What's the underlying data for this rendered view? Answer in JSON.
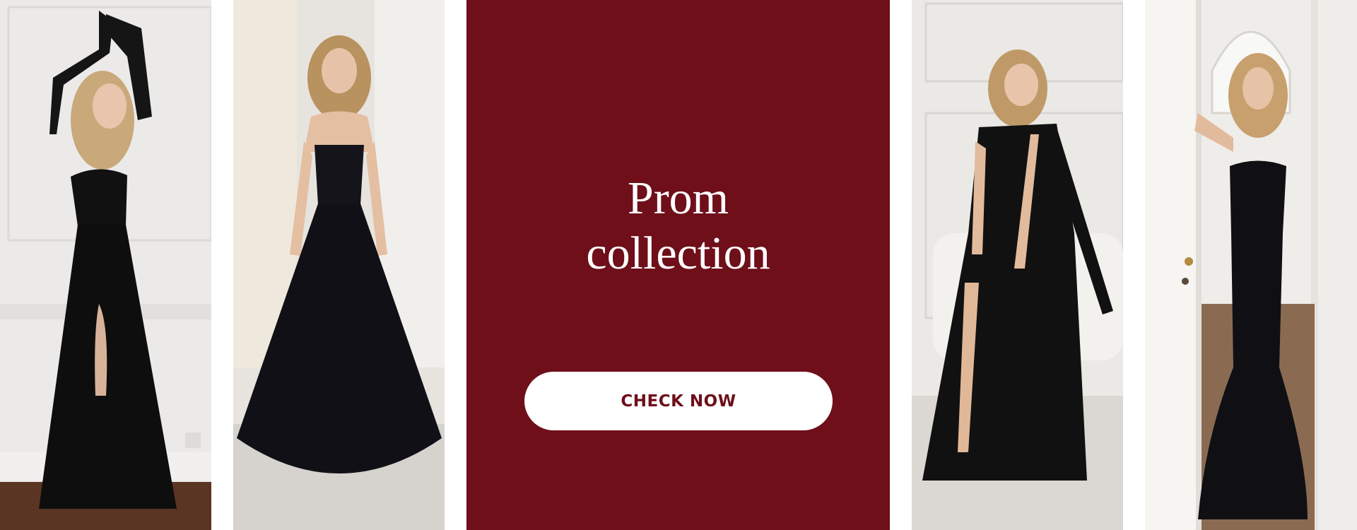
{
  "promo": {
    "title_line1": "Prom",
    "title_line2": "collection",
    "cta_label": "CHECK NOW"
  },
  "colors": {
    "promo_background": "#6e0f1a",
    "cta_background": "#ffffff",
    "cta_text": "#6e0f1a",
    "title_text": "#ffffff"
  },
  "photos": [
    {
      "icon": "model-black-gown-arms-raised-photo"
    },
    {
      "icon": "model-black-strapless-ballgown-photo"
    },
    {
      "icon": "model-black-tie-strap-dress-photo"
    },
    {
      "icon": "model-black-mermaid-gown-doorway-photo"
    }
  ]
}
